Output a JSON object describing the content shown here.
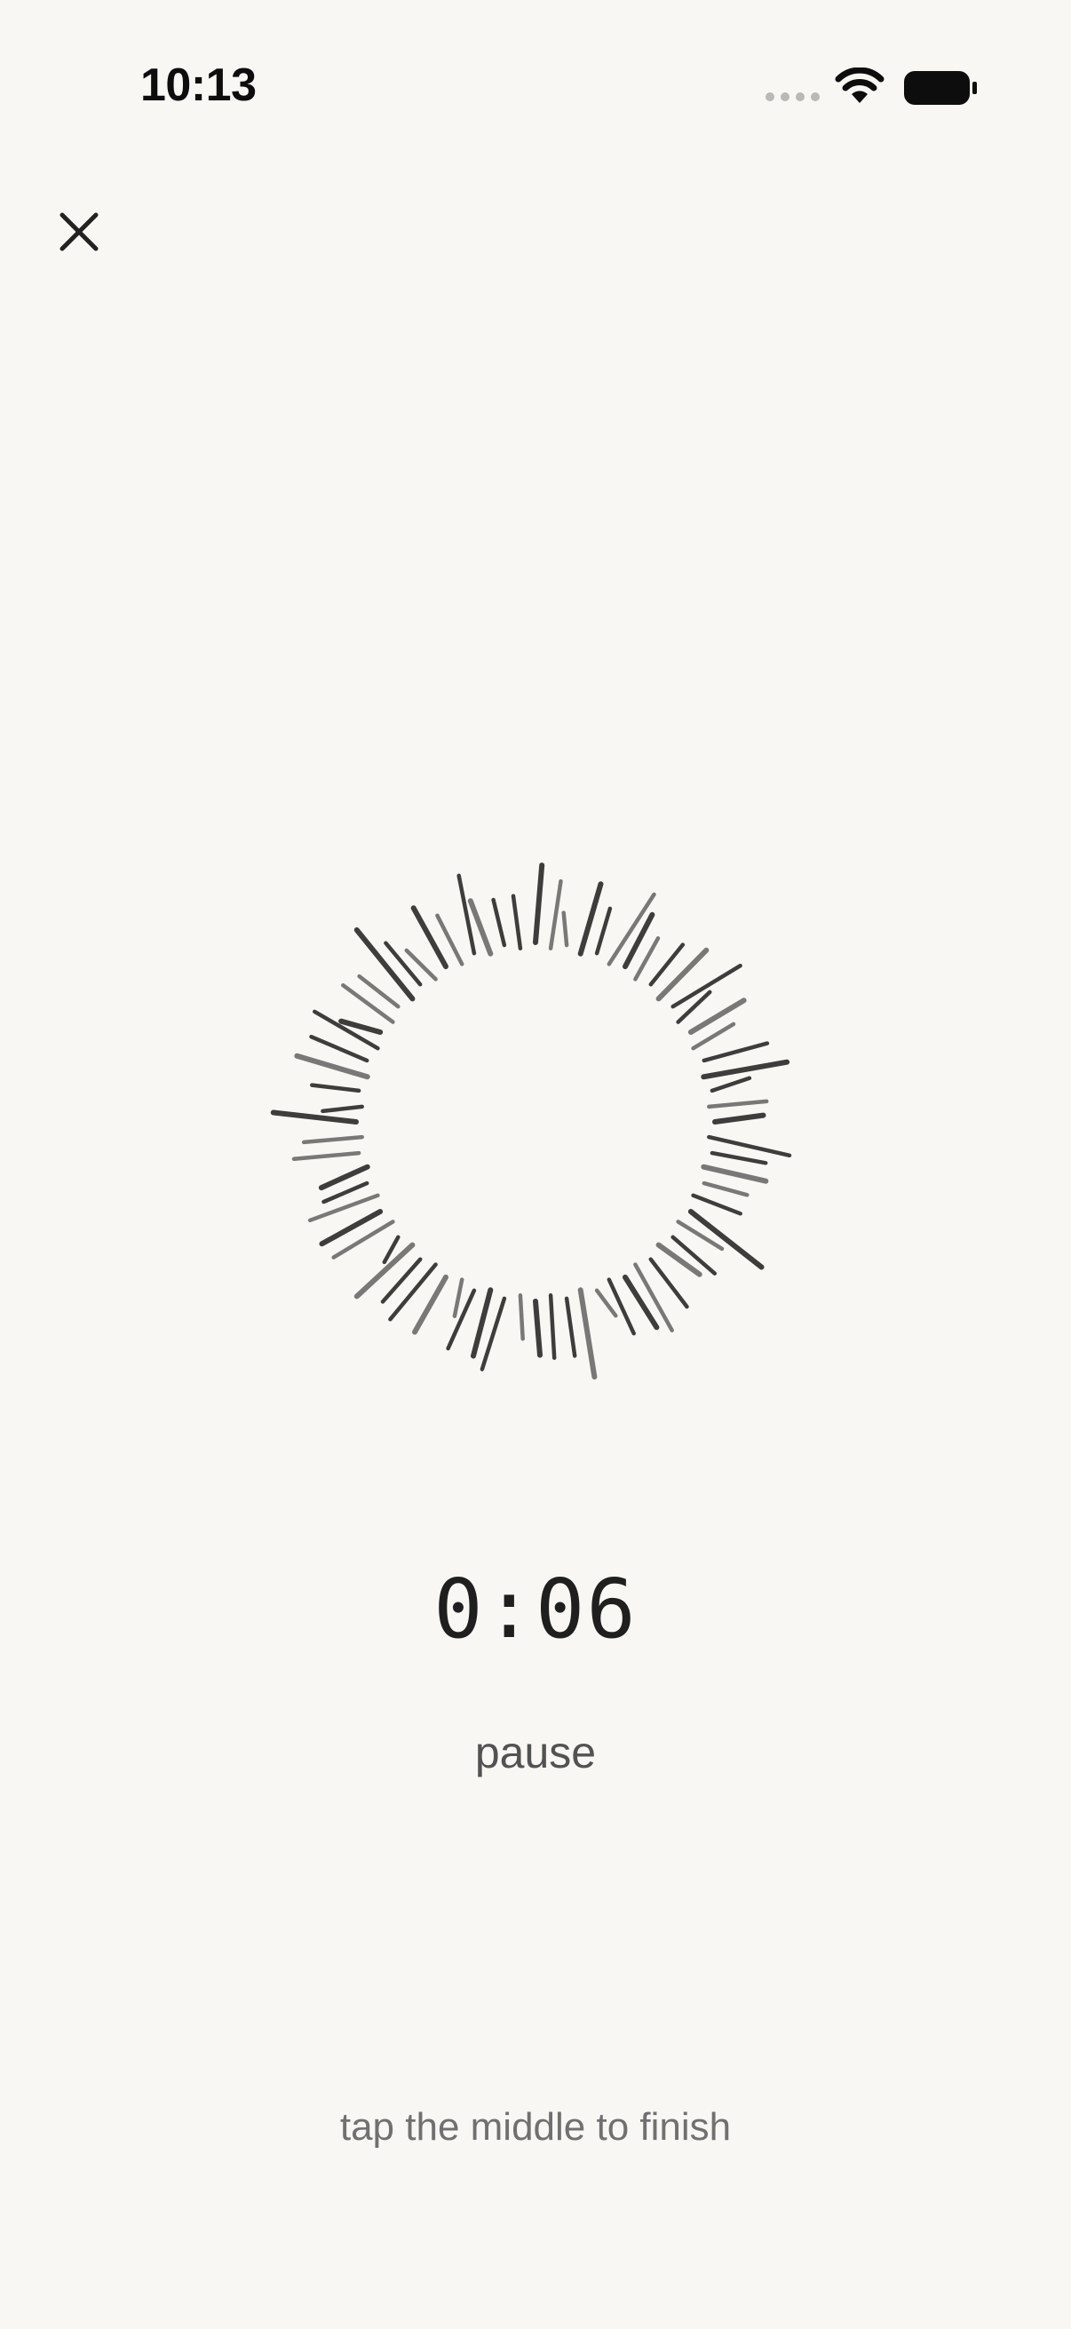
{
  "status_bar": {
    "time": "10:13",
    "icons": [
      "signal-dots-icon",
      "wifi-icon",
      "battery-icon"
    ]
  },
  "header": {
    "close_icon": "close-icon"
  },
  "exercise": {
    "timer": "0:06",
    "pause_label": "pause",
    "hint": "tap the middle to finish"
  },
  "colors": {
    "background": "#f8f7f3",
    "ink": "#232323",
    "muted": "#707070"
  }
}
